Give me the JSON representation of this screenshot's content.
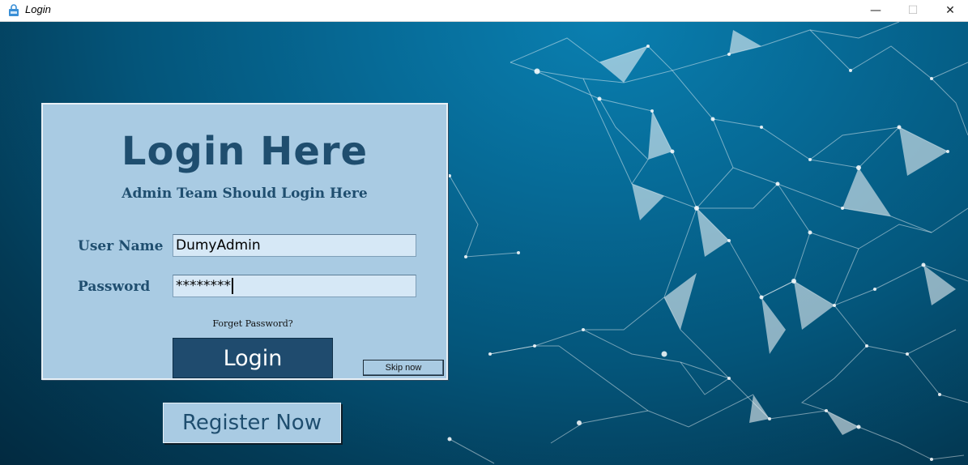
{
  "window": {
    "title": "Login",
    "controls": {
      "minimize": "—",
      "maximize": "☐",
      "close": "✕"
    }
  },
  "login_card": {
    "title": "Login Here",
    "subtitle": "Admin Team Should Login Here",
    "username_label": "User Name",
    "username_value": "DumyAdmin",
    "password_label": "Password",
    "password_value": "********",
    "forgot_password": "Forget Password?",
    "login_button": "Login",
    "skip_button": "Skip now"
  },
  "register_button": "Register Now",
  "colors": {
    "card_bg": "#a9cbe3",
    "accent_dark": "#1f4e6f",
    "login_button_bg": "#1f4b6e",
    "field_bg": "#d6e8f6",
    "background": "#04557a"
  },
  "icons": {
    "app": "lock-icon"
  }
}
